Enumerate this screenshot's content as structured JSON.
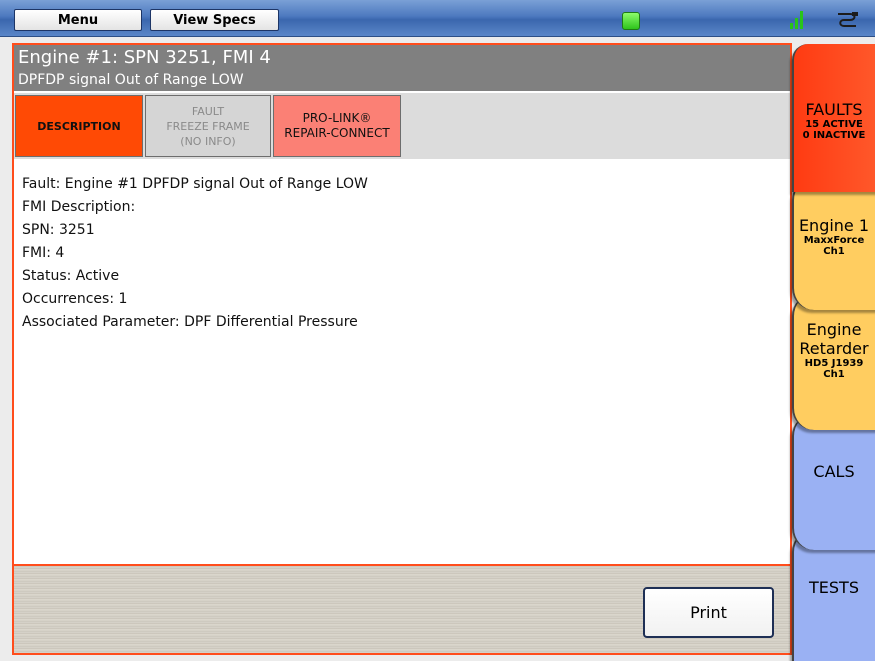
{
  "topbar": {
    "menu_label": "Menu",
    "view_specs_label": "View Specs",
    "status_color": "#2ec41c"
  },
  "fault": {
    "title": "Engine #1: SPN 3251, FMI 4",
    "subtitle": "DPFDP signal Out of Range LOW"
  },
  "detail_tabs": [
    {
      "lines": [
        "DESCRIPTION"
      ],
      "active": true
    },
    {
      "lines": [
        "FAULT",
        "FREEZE FRAME",
        "(NO INFO)"
      ],
      "disabled": true
    },
    {
      "lines": [
        "PRO-LINK®",
        "REPAIR-CONNECT"
      ]
    }
  ],
  "description_lines": [
    "Fault: Engine #1 DPFDP signal Out of Range LOW",
    "FMI Description:",
    "SPN: 3251",
    "FMI: 4",
    "Status: Active",
    "Occurrences: 1",
    "Associated Parameter: DPF Differential Pressure"
  ],
  "footer": {
    "print_label": "Print"
  },
  "side_tabs": {
    "faults": {
      "title": "FAULTS",
      "line1": "15 ACTIVE",
      "line2": "0 INACTIVE"
    },
    "engine1": {
      "title": "Engine 1",
      "line1": "MaxxForce",
      "line2": "Ch1"
    },
    "retarder": {
      "title1": "Engine",
      "title2": "Retarder",
      "line1": "HD5 J1939",
      "line2": "Ch1"
    },
    "cals": {
      "title": "CALS"
    },
    "tests": {
      "title": "TESTS"
    }
  },
  "colors": {
    "accent": "#ff4a05",
    "engine_tab": "#ffcd60",
    "blue_tab": "#9ab1f3"
  }
}
